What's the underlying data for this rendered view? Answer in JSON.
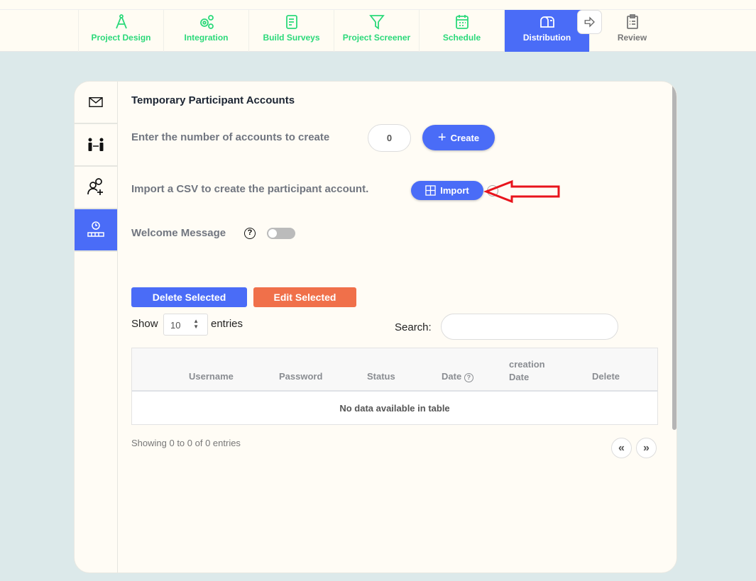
{
  "nav": {
    "tabs": [
      {
        "label": "Project Design",
        "icon": "compass-icon"
      },
      {
        "label": "Integration",
        "icon": "gears-icon"
      },
      {
        "label": "Build Surveys",
        "icon": "document-icon"
      },
      {
        "label": "Project Screener",
        "icon": "filter-icon"
      },
      {
        "label": "Schedule",
        "icon": "calendar-icon"
      },
      {
        "label": "Distribution",
        "icon": "mailbox-icon",
        "active": true
      },
      {
        "label": "Review",
        "icon": "clipboard-icon"
      }
    ]
  },
  "sidebar": {
    "items": [
      {
        "icon": "envelope-icon"
      },
      {
        "icon": "people-exchange-icon"
      },
      {
        "icon": "add-user-icon"
      },
      {
        "icon": "timed-participant-icon",
        "active": true
      }
    ]
  },
  "main": {
    "title": "Temporary Participant Accounts",
    "create_label": "Enter the number of accounts to create",
    "create_count": "0",
    "create_button": "Create",
    "import_label": "Import a CSV to create the participant account.",
    "import_button": "Import",
    "welcome_label": "Welcome Message",
    "welcome_enabled": false,
    "delete_selected": "Delete Selected",
    "edit_selected": "Edit Selected",
    "show": "Show",
    "entries_value": "10",
    "entries": "entries",
    "search_label": "Search:",
    "search_value": "",
    "columns": [
      "Username",
      "Password",
      "Status",
      "Date",
      "creation Date",
      "Delete"
    ],
    "empty": "No data available in table",
    "info": "Showing 0 to 0 of 0 entries",
    "prev": "«",
    "next": "»"
  },
  "colors": {
    "accent": "#4a6cf7",
    "nav_green": "#2bd97a",
    "edit": "#f0704a",
    "annotation_arrow": "#e8141c"
  }
}
